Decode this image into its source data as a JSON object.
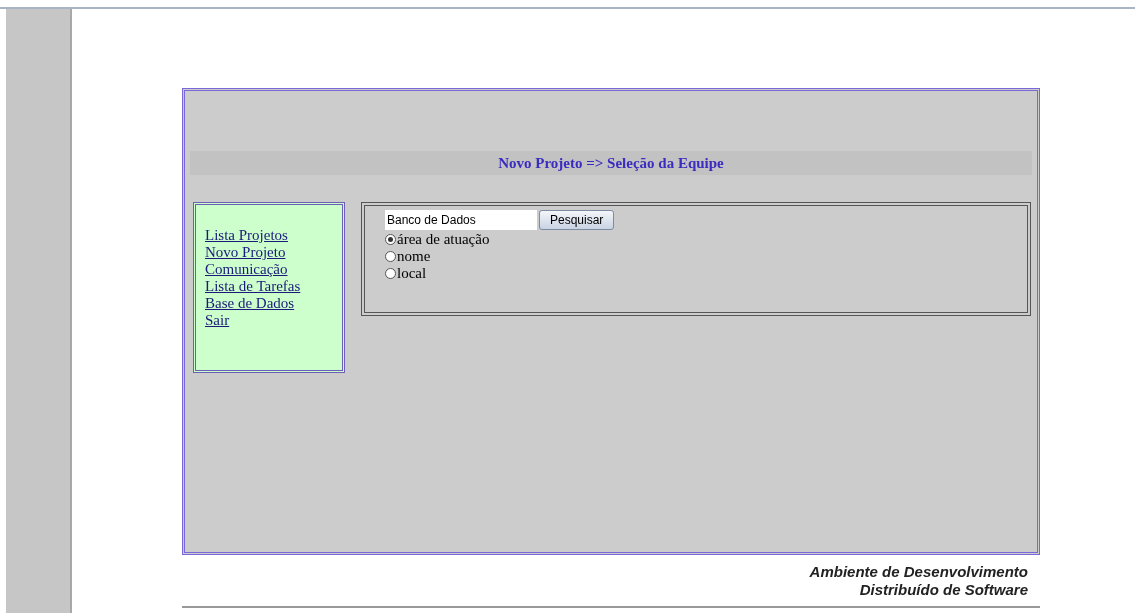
{
  "header": {
    "title": "Novo Projeto => Seleção da Equipe"
  },
  "nav": {
    "items": [
      {
        "label": "Lista Projetos"
      },
      {
        "label": "Novo Projeto"
      },
      {
        "label": "Comunicação"
      },
      {
        "label": "Lista de Tarefas"
      },
      {
        "label": "Base de Dados"
      },
      {
        "label": "Sair"
      }
    ]
  },
  "search": {
    "value": "Banco de Dados",
    "button": "Pesquisar",
    "options": [
      {
        "label": "área de atuação",
        "selected": true
      },
      {
        "label": "nome",
        "selected": false
      },
      {
        "label": "local",
        "selected": false
      }
    ]
  },
  "footer": {
    "lines": [
      "Ambiente de Desenvolvimento",
      "Distribuído de Software"
    ]
  }
}
